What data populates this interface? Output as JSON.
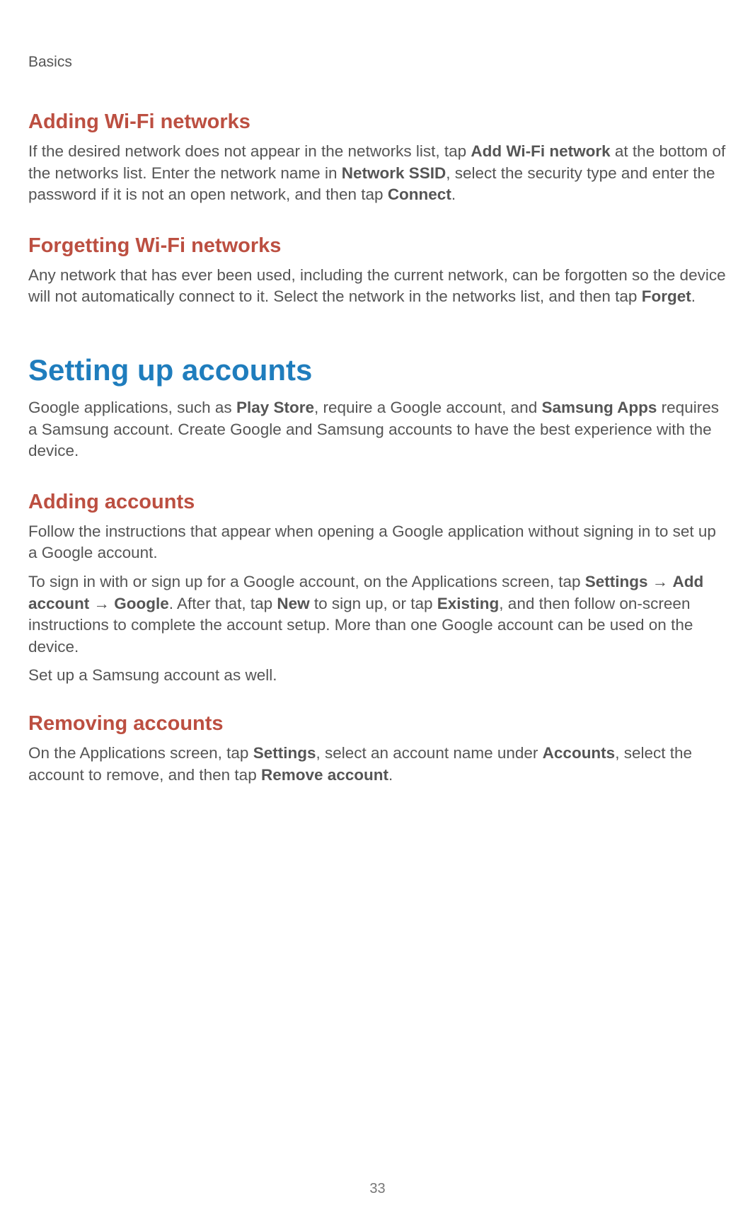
{
  "header": {
    "section_label": "Basics"
  },
  "wifi_add": {
    "heading": "Adding Wi-Fi networks",
    "p1_a": "If the desired network does not appear in the networks list, tap ",
    "p1_b": "Add Wi-Fi network",
    "p1_c": " at the bottom of the networks list. Enter the network name in ",
    "p1_d": "Network SSID",
    "p1_e": ", select the security type and enter the password if it is not an open network, and then tap ",
    "p1_f": "Connect",
    "p1_g": "."
  },
  "wifi_forget": {
    "heading": "Forgetting Wi-Fi networks",
    "p1_a": "Any network that has ever been used, including the current network, can be forgotten so the device will not automatically connect to it. Select the network in the networks list, and then tap ",
    "p1_b": "Forget",
    "p1_c": "."
  },
  "accounts": {
    "heading": "Setting up accounts",
    "p1_a": "Google applications, such as ",
    "p1_b": "Play Store",
    "p1_c": ", require a Google account, and ",
    "p1_d": "Samsung Apps",
    "p1_e": " requires a Samsung account. Create Google and Samsung accounts to have the best experience with the device."
  },
  "add_accounts": {
    "heading": "Adding accounts",
    "p1": "Follow the instructions that appear when opening a Google application without signing in to set up a Google account.",
    "p2_a": "To sign in with or sign up for a Google account, on the Applications screen, tap ",
    "p2_b": "Settings",
    "p2_arrow1": " → ",
    "p2_c": "Add account",
    "p2_arrow2": " → ",
    "p2_d": "Google",
    "p2_e": ". After that, tap ",
    "p2_f": "New",
    "p2_g": " to sign up, or tap ",
    "p2_h": "Existing",
    "p2_i": ", and then follow on-screen instructions to complete the account setup. More than one Google account can be used on the device.",
    "p3": "Set up a Samsung account as well."
  },
  "remove_accounts": {
    "heading": "Removing accounts",
    "p1_a": "On the Applications screen, tap ",
    "p1_b": "Settings",
    "p1_c": ", select an account name under ",
    "p1_d": "Accounts",
    "p1_e": ", select the account to remove, and then tap ",
    "p1_f": "Remove account",
    "p1_g": "."
  },
  "page_number": "33"
}
